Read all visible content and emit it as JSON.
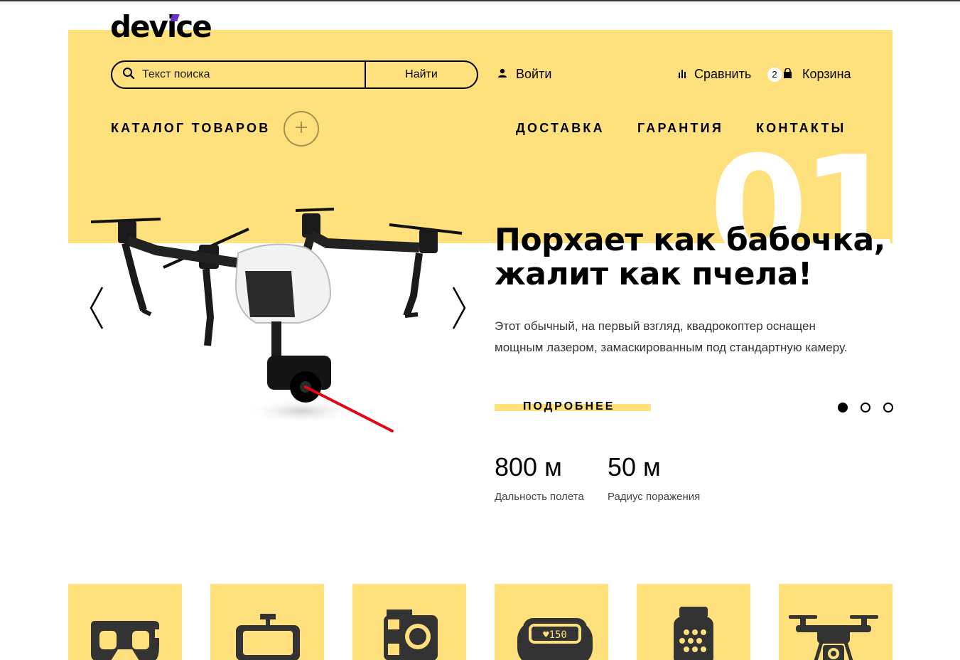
{
  "header": {
    "logo": "device",
    "search": {
      "placeholder": "Текст поиска",
      "button": "Найти"
    },
    "login": "Войти",
    "compare": "Сравнить",
    "cart": {
      "count": "2",
      "label": "Корзина"
    }
  },
  "nav": {
    "catalog": "КАТАЛОГ ТОВАРОВ",
    "links": [
      "ДОСТАВКА",
      "ГАРАНТИЯ",
      "КОНТАКТЫ"
    ]
  },
  "slider": {
    "number": "01",
    "title_line1": "Порхает как бабочка,",
    "title_line2": "жалит как пчела!",
    "description_line1": "Этот обычный, на первый взгляд, квадрокоптер оснащен",
    "description_line2": "мощным лазером, замаскированным под стандартную камеру.",
    "more_button": "ПОДРОБНЕЕ",
    "active_dot": 1,
    "dot_count": 3,
    "stats": [
      {
        "value": "800 м",
        "label": "Дальность полета"
      },
      {
        "value": "50 м",
        "label": "Радиус поражения"
      }
    ]
  },
  "categories": [
    {
      "icon": "vr-headset-icon"
    },
    {
      "icon": "selfie-stick-icon"
    },
    {
      "icon": "action-camera-icon"
    },
    {
      "icon": "fitness-band-icon"
    },
    {
      "icon": "smartwatch-icon"
    },
    {
      "icon": "drone-icon"
    }
  ],
  "colors": {
    "accent": "#fee17d",
    "text": "#000000",
    "laser": "#e30613"
  }
}
